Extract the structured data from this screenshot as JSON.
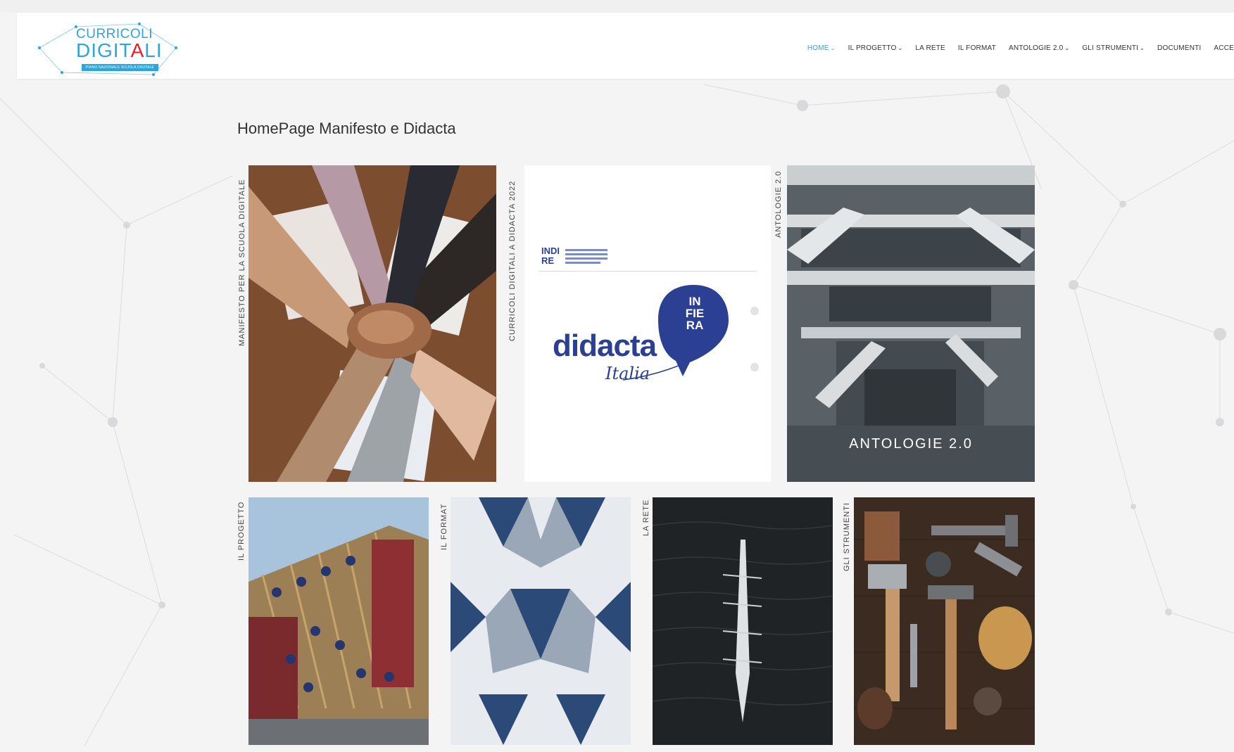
{
  "site": {
    "logo": {
      "line1": "CURRICOLI",
      "line2_a": "DIGIT",
      "line2_b": "A",
      "line2_c": "LI",
      "tagline": "PIANO NAZIONALE SCUOLA DIGITALE"
    },
    "nav": [
      {
        "label": "HOME",
        "has_dropdown": true,
        "active": true
      },
      {
        "label": "IL PROGETTO",
        "has_dropdown": true,
        "active": false
      },
      {
        "label": "LA RETE",
        "has_dropdown": false,
        "active": false
      },
      {
        "label": "IL FORMAT",
        "has_dropdown": false,
        "active": false
      },
      {
        "label": "ANTOLOGIE 2.0",
        "has_dropdown": true,
        "active": false
      },
      {
        "label": "GLI STRUMENTI",
        "has_dropdown": true,
        "active": false
      },
      {
        "label": "DOCUMENTI",
        "has_dropdown": false,
        "active": false
      },
      {
        "label": "ACCE",
        "has_dropdown": false,
        "active": false
      }
    ]
  },
  "page": {
    "title": "HomePage Manifesto e Didacta"
  },
  "tiles": {
    "manifesto": {
      "label": "MANIFESTO PER LA SCUOLA DIGITALE"
    },
    "didacta": {
      "label": "CURRICOLI DIGITALI A DIDACTA 2022",
      "brand": "didacta",
      "brand_sub": "Italia",
      "badge": "IN FIE RA",
      "indire": "INDIRE"
    },
    "antologie": {
      "label": "ANTOLOGIE 2.0",
      "caption": "ANTOLOGIE 2.0"
    },
    "progetto": {
      "label": "IL PROGETTO"
    },
    "format": {
      "label": "IL FORMAT"
    },
    "rete": {
      "label": "LA RETE"
    },
    "strumenti": {
      "label": "GLI STRUMENTI"
    }
  },
  "colors": {
    "accent": "#2ea4dc",
    "logo_red": "#e4202e",
    "didacta_blue": "#2b3f93"
  }
}
